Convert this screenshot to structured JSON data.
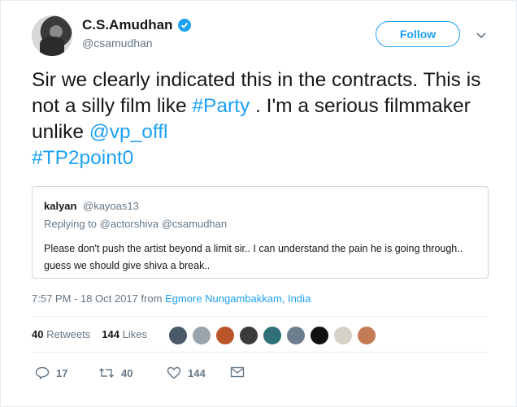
{
  "author": {
    "name": "C.S.Amudhan",
    "handle": "@csamudhan"
  },
  "follow_label": "Follow",
  "tweet": {
    "p1": "Sir we clearly indicated this in the contracts. This is not a silly film like ",
    "party": "#Party",
    "p2": " . I'm a serious filmmaker unlike ",
    "vp": "@vp_offl",
    "tp": "#TP2point0"
  },
  "quoted": {
    "name": "kalyan",
    "handle": "@kayoas13",
    "replying": "Replying to @actorshiva @csamudhan",
    "text": "Please don't push the artist beyond a limit sir.. I can understand the pain he is going through.. guess we should give shiva a break.."
  },
  "meta": {
    "time": "7:57 PM - 18 Oct 2017 from ",
    "location": "Egmore Nungambakkam, India"
  },
  "stats": {
    "retweets": "40",
    "retweets_label": "Retweets",
    "likes": "144",
    "likes_label": "Likes"
  },
  "actions": {
    "replies": "17",
    "retweets": "40",
    "likes": "144"
  },
  "colors": {
    "accent": "#1da1f2",
    "text": "#14171a",
    "muted": "#657786"
  },
  "icons": [
    "verified-icon",
    "chevron-down-icon",
    "reply-icon",
    "retweet-icon",
    "like-icon",
    "message-icon"
  ]
}
